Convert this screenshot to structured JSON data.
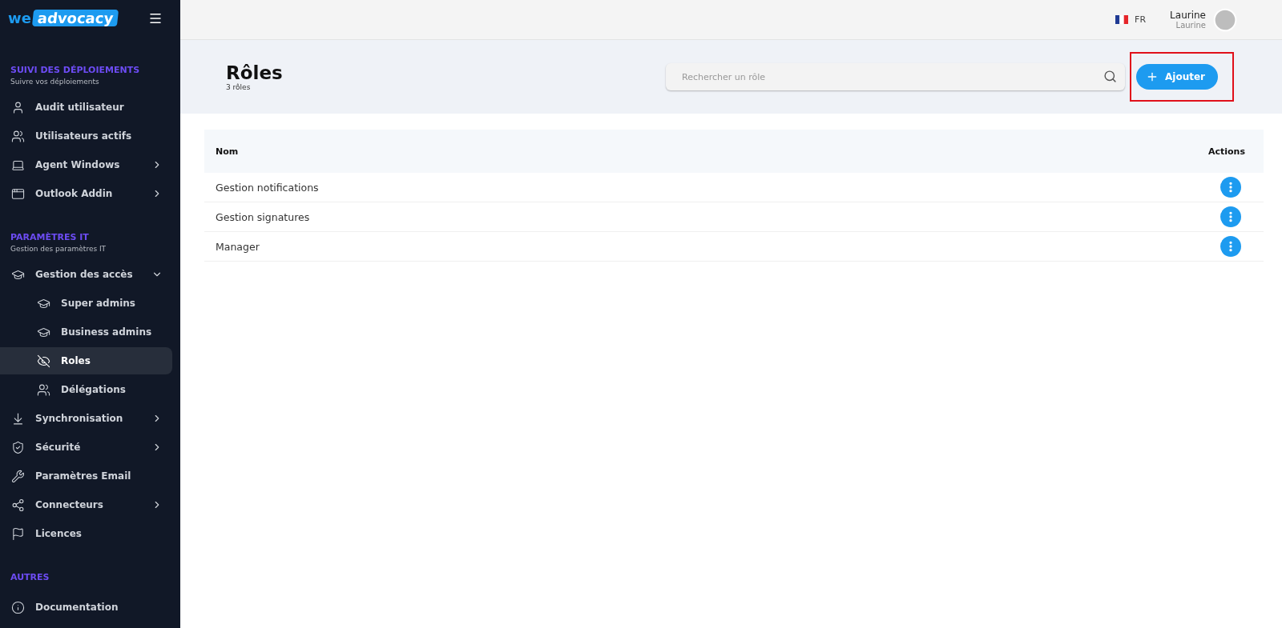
{
  "sidebar": {
    "logo": {
      "part_1": "we",
      "part_2": "advocacy"
    },
    "sections": [
      {
        "title": "SUIVI DES DÉPLOIEMENTS",
        "subtitle": "Suivre vos déploiements",
        "items": [
          {
            "label": "Audit utilisateur",
            "selected": false
          },
          {
            "label": "Utilisateurs actifs",
            "selected": false
          },
          {
            "label": "Agent Windows",
            "selected": false,
            "expandable": true,
            "expanded": false
          },
          {
            "label": "Outlook Addin",
            "selected": false,
            "expandable": true,
            "expanded": false
          }
        ]
      },
      {
        "title": "PARAMÈTRES IT",
        "subtitle": "Gestion des paramètres IT",
        "items": [
          {
            "label": "Gestion des accès",
            "selected": false,
            "expandable": true,
            "expanded": true,
            "children": [
              {
                "label": "Super admins",
                "selected": false
              },
              {
                "label": "Business admins",
                "selected": false
              },
              {
                "label": "Roles",
                "selected": true
              },
              {
                "label": "Délégations",
                "selected": false
              }
            ]
          },
          {
            "label": "Synchronisation",
            "selected": false,
            "expandable": true,
            "expanded": false
          },
          {
            "label": "Sécurité",
            "selected": false,
            "expandable": true,
            "expanded": false
          },
          {
            "label": "Paramètres Email",
            "selected": false
          },
          {
            "label": "Connecteurs",
            "selected": false,
            "expandable": true,
            "expanded": false
          },
          {
            "label": "Licences",
            "selected": false
          }
        ]
      },
      {
        "title": "AUTRES",
        "items": [
          {
            "label": "Documentation",
            "selected": false
          }
        ]
      }
    ]
  },
  "topbar": {
    "language": "FR",
    "user": {
      "name": "Laurine",
      "subtitle": "Laurine"
    }
  },
  "header": {
    "title": "Rôles",
    "count": "3 rôles",
    "search": {
      "placeholder": "Rechercher un rôle"
    },
    "add_button": {
      "label": "Ajouter",
      "highlighted": true
    }
  },
  "table": {
    "columns": [
      "Nom",
      "Actions"
    ],
    "rows": [
      {
        "name": "Gestion notifications"
      },
      {
        "name": "Gestion signatures"
      },
      {
        "name": "Manager"
      }
    ]
  }
}
